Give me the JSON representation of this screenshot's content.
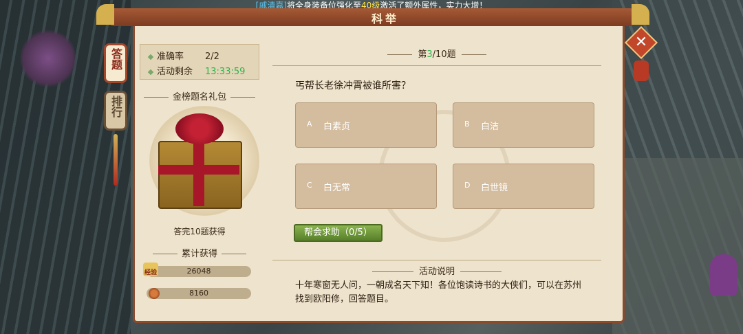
{
  "announcement": {
    "name": "[戚清嘉]",
    "text1": "将全身装备位强化至",
    "level": "40级",
    "text2": "激活了额外属性，实力大增！"
  },
  "window": {
    "title": "科举"
  },
  "tabs": [
    {
      "label": "答题"
    },
    {
      "label": "排行"
    }
  ],
  "stats": {
    "accuracy_label": "准确率",
    "accuracy_value": "2/2",
    "time_label": "活动剩余",
    "time_value": "13:33:59"
  },
  "gift": {
    "heading": "金榜题名礼包",
    "caption": "答完10题获得"
  },
  "rewards": {
    "heading": "累计获得",
    "exp_icon_label": "经验",
    "exp_value": "26048",
    "coin_value": "8160"
  },
  "question": {
    "prefix": "第",
    "current": "3",
    "suffix": "/10题",
    "text": "丐帮长老徐冲霄被谁所害？",
    "options": [
      {
        "letter": "A",
        "text": "白素贞"
      },
      {
        "letter": "B",
        "text": "白洁"
      },
      {
        "letter": "C",
        "text": "白无常"
      },
      {
        "letter": "D",
        "text": "白世镜"
      }
    ]
  },
  "help_button": {
    "label": "帮会求助（0/5）"
  },
  "description": {
    "heading": "活动说明",
    "text": "十年寒窗无人问，一朝成名天下知！各位饱读诗书的大侠们，可以在苏州找到欧阳修，回答题目。"
  },
  "colors": {
    "accent_green": "#2bb34a",
    "frame": "#8b4a2c",
    "panel": "#eee3cc"
  }
}
